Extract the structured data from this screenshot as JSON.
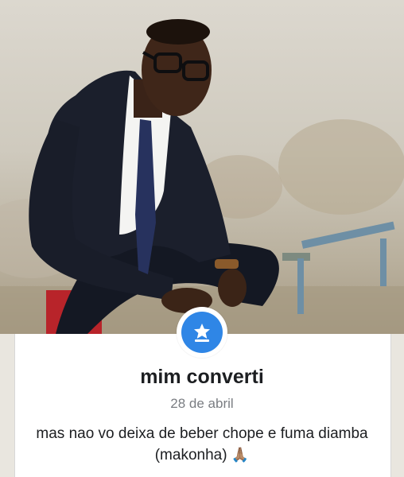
{
  "post": {
    "title": "mim converti",
    "date": "28 de abril",
    "caption": "mas nao vo deixa de beber chope e fuma diamba (makonha)",
    "emoji": "🙏🏽"
  },
  "colors": {
    "badge_blue": "#2f86e6",
    "title_text": "#1c1e21",
    "date_text": "#7a7d82",
    "card_bg": "#ffffff"
  },
  "icons": {
    "badge": "star-icon"
  }
}
